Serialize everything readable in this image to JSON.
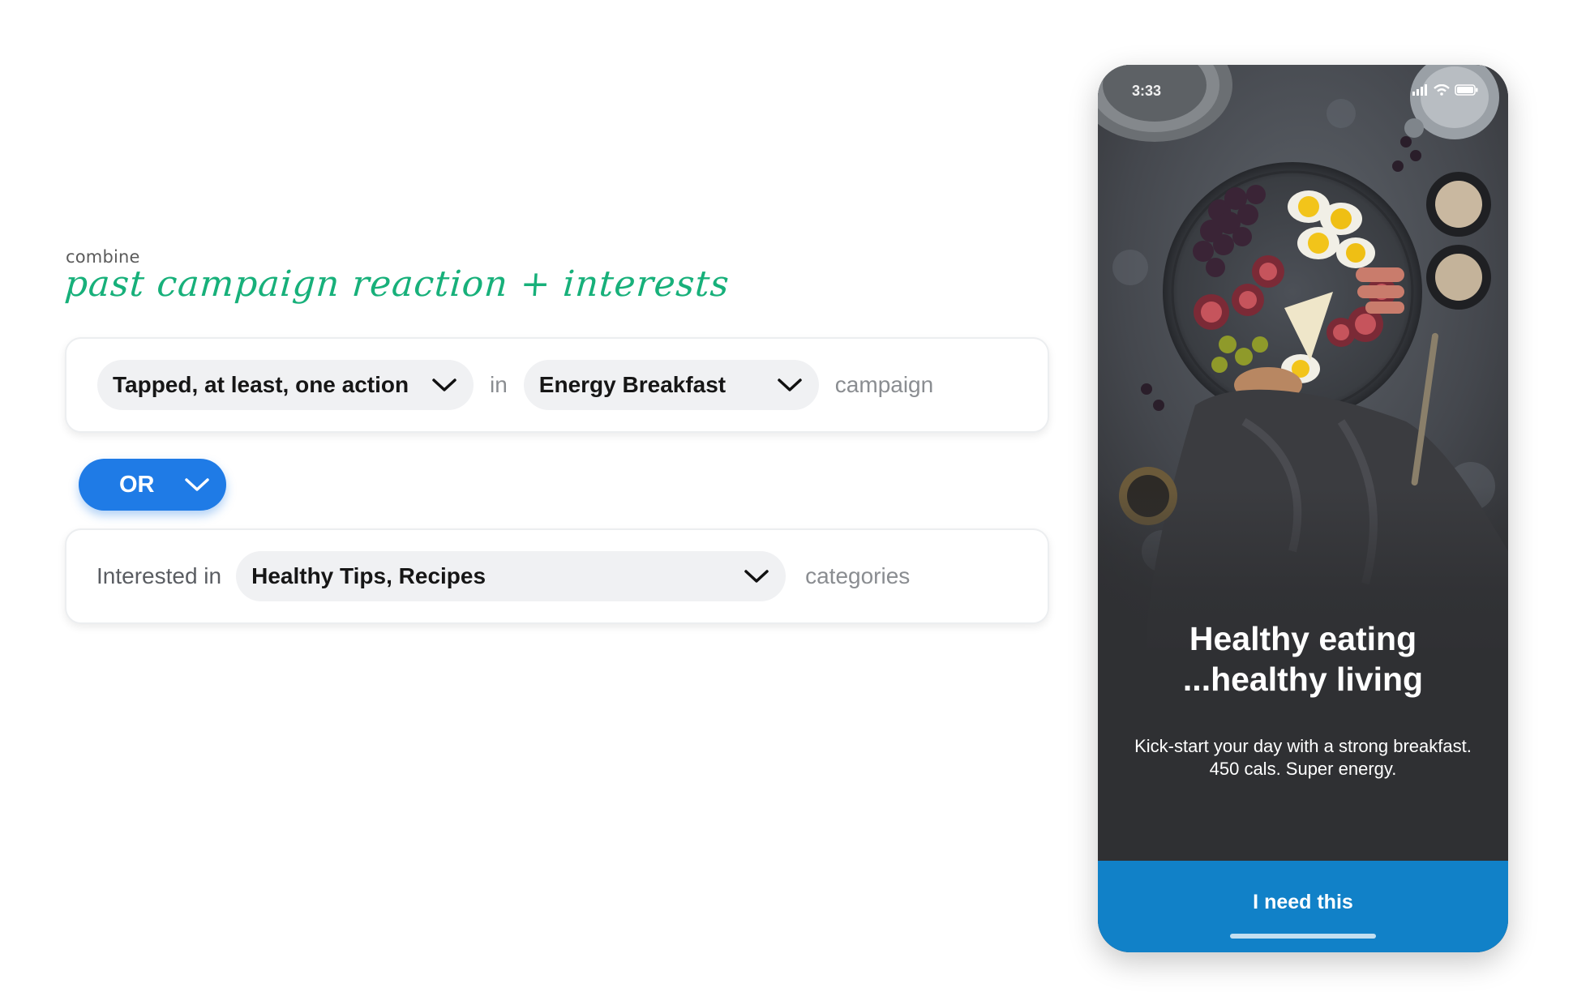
{
  "builder": {
    "kicker": "combine",
    "headline": "past campaign reaction + interests",
    "rule1": {
      "action_label": "Tapped, at least, one action",
      "connector": "in",
      "campaign_label": "Energy Breakfast",
      "suffix": "campaign"
    },
    "operator_label": "OR",
    "rule2": {
      "prefix": "Interested in",
      "categories_label": "Healthy Tips, Recipes",
      "suffix": "categories"
    }
  },
  "phone": {
    "status": {
      "time": "3:33",
      "icons": [
        "signal-icon",
        "wifi-icon",
        "battery-icon"
      ]
    },
    "title_lines": [
      "Healthy eating",
      "...healthy living"
    ],
    "body_lines": [
      "Kick-start your day with a strong breakfast.",
      "450 cals. Super energy."
    ],
    "cta_label": "I need this"
  },
  "colors": {
    "accent_green": "#17b07a",
    "or_blue": "#1f7be6",
    "cta_blue": "#1181c8",
    "phone_bg": "#2f3033"
  }
}
